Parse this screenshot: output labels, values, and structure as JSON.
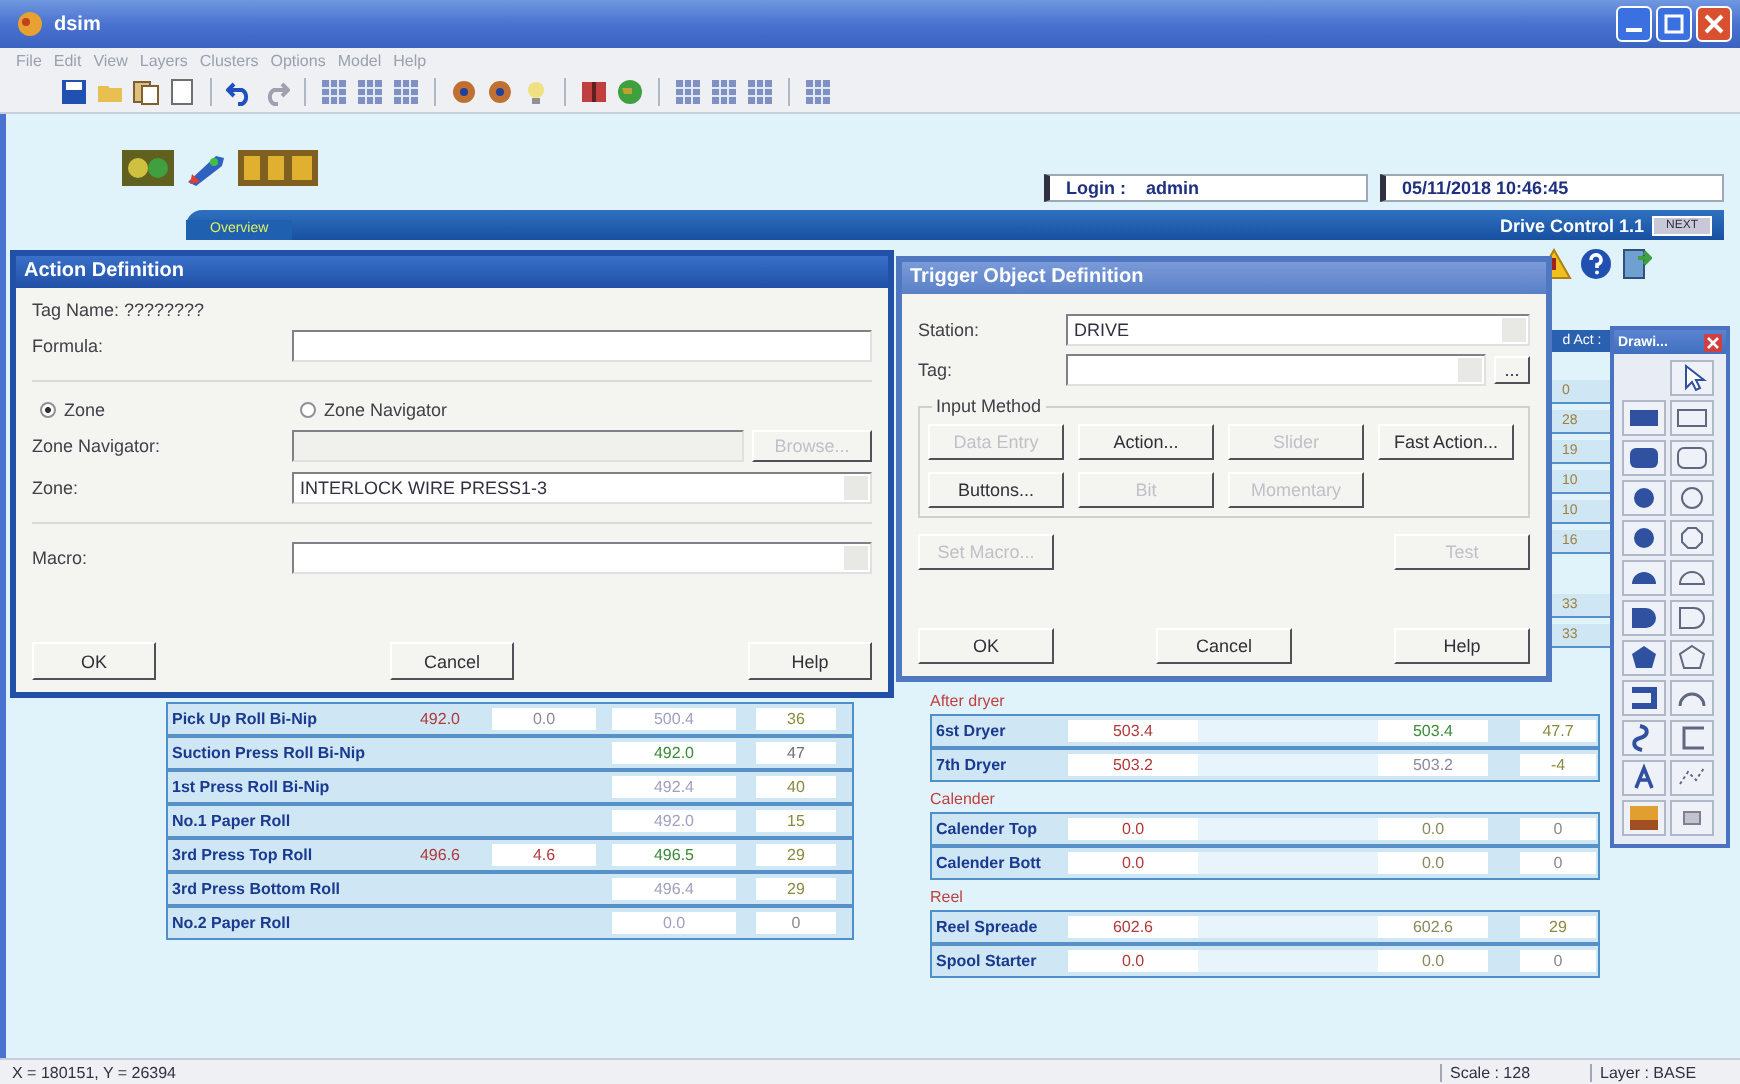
{
  "window": {
    "title": "dsim"
  },
  "menu": [
    "File",
    "Edit",
    "View",
    "Layers",
    "Clusters",
    "Options",
    "Model",
    "Help"
  ],
  "header": {
    "login_label": "Login :",
    "login_user": "admin",
    "datetime": "05/11/2018 10:46:45",
    "tab": "Overview",
    "screen_title": "Drive Control 1.1",
    "next_button": "NEXT"
  },
  "partial_column": {
    "header": "d Act :",
    "values": [
      "0",
      "28",
      "19",
      "10",
      "10",
      "16"
    ],
    "values_lower": [
      "33",
      "33"
    ]
  },
  "left_table": {
    "rows": [
      {
        "name": "Pick Up Roll Bi-Nip",
        "column_2": {
          "text": "492.0",
          "color": "#b03a3a"
        },
        "column_3": {
          "text": "0.0",
          "color": "#8a8a9a"
        },
        "column_4": {
          "text": "500.4",
          "color": "#a0a0c0"
        },
        "column_5": {
          "text": "36",
          "color": "#8a8a40"
        }
      },
      {
        "name": "Suction Press Roll Bi-Nip",
        "column_4": {
          "text": "492.0",
          "color": "#3a8a3a"
        },
        "column_5": {
          "text": "47",
          "color": "#707070"
        }
      },
      {
        "name": "1st Press Roll Bi-Nip",
        "column_4": {
          "text": "492.4",
          "color": "#a0a0c0"
        },
        "column_5": {
          "text": "40",
          "color": "#8a8a40"
        }
      },
      {
        "name": "No.1 Paper Roll",
        "column_4": {
          "text": "492.0",
          "color": "#a0a0c0"
        },
        "column_5": {
          "text": "15",
          "color": "#8a8a40"
        }
      },
      {
        "name": "3rd Press Top Roll",
        "column_2": {
          "text": "496.6",
          "color": "#b03a3a"
        },
        "column_3": {
          "text": "4.6",
          "color": "#b03a3a"
        },
        "column_4": {
          "text": "496.5",
          "color": "#3a8a3a"
        },
        "column_5": {
          "text": "29",
          "color": "#8a8a40"
        }
      },
      {
        "name": "3rd Press Bottom Roll",
        "column_4": {
          "text": "496.4",
          "color": "#a0a0c0"
        },
        "column_5": {
          "text": "29",
          "color": "#8a8a40"
        }
      },
      {
        "name": "No.2 Paper Roll",
        "column_4": {
          "text": "0.0",
          "color": "#a0a0c0"
        },
        "column_5": {
          "text": "0",
          "color": "#8a8a8a"
        }
      }
    ]
  },
  "right_table": {
    "groups": [
      {
        "label": "After dryer",
        "rows": [
          {
            "name": "6st Dryer",
            "column_2": {
              "text": "503.4",
              "color": "#b03a3a"
            },
            "column_3": {
              "text": "503.4",
              "color": "#3a8a3a"
            },
            "column_4": {
              "text": "47.7",
              "color": "#8a8a40"
            }
          },
          {
            "name": "7th Dryer",
            "column_2": {
              "text": "503.2",
              "color": "#b03a3a"
            },
            "column_3": {
              "text": "503.2",
              "color": "#8a8aa0"
            },
            "column_4": {
              "text": "-4",
              "color": "#8a8a40"
            }
          }
        ]
      },
      {
        "label": "Calender",
        "rows": [
          {
            "name": "Calender Top",
            "column_2": {
              "text": "0.0",
              "color": "#b03a3a"
            },
            "column_3": {
              "text": "0.0",
              "color": "#8a8a60"
            },
            "column_4": {
              "text": "0",
              "color": "#8a8a8a"
            }
          },
          {
            "name": "Calender Bott",
            "column_2": {
              "text": "0.0",
              "color": "#b03a3a"
            },
            "column_3": {
              "text": "0.0",
              "color": "#8a8a60"
            },
            "column_4": {
              "text": "0",
              "color": "#8a8a8a"
            }
          }
        ]
      },
      {
        "label": "Reel",
        "rows": [
          {
            "name": "Reel Spreade",
            "column_2": {
              "text": "602.6",
              "color": "#b03a3a"
            },
            "column_3": {
              "text": "602.6",
              "color": "#8a8a60"
            },
            "column_4": {
              "text": "29",
              "color": "#8a8a40"
            }
          },
          {
            "name": "Spool Starter",
            "column_2": {
              "text": "0.0",
              "color": "#b03a3a"
            },
            "column_3": {
              "text": "0.0",
              "color": "#8a8a60"
            },
            "column_4": {
              "text": "0",
              "color": "#8a8a8a"
            }
          }
        ]
      }
    ]
  },
  "action_dialog": {
    "title": "Action Definition",
    "tag_name": "Tag Name: ????????",
    "formula_label": "Formula:",
    "radios": [
      {
        "label": "Zone",
        "selected": true
      },
      {
        "label": "Zone Navigator",
        "selected": false
      }
    ],
    "zone_navigator_label": "Zone Navigator:",
    "browse_button": {
      "label": "Browse...",
      "disabled": true
    },
    "zone_label": "Zone:",
    "zone_value": "INTERLOCK WIRE PRESS1-3",
    "macro_label": "Macro:",
    "buttons": [
      "OK",
      "Cancel",
      "Help"
    ]
  },
  "trigger_dialog": {
    "title": "Trigger Object Definition",
    "station_label": "Station:",
    "station_value": "DRIVE",
    "tag_label": "Tag:",
    "browse_button": "...",
    "group_label": "Input Method",
    "method_buttons": [
      {
        "label": "Data Entry",
        "disabled": true
      },
      {
        "label": "Action...",
        "disabled": false
      },
      {
        "label": "Slider",
        "disabled": true
      },
      {
        "label": "Fast Action...",
        "disabled": false
      },
      {
        "label": "Buttons...",
        "disabled": false
      },
      {
        "label": "Bit",
        "disabled": true
      },
      {
        "label": "Momentary",
        "disabled": true
      }
    ],
    "macro_button": {
      "label": "Set Macro...",
      "disabled": true
    },
    "test_button": {
      "label": "Test",
      "disabled": true
    },
    "buttons": [
      "OK",
      "Cancel",
      "Help"
    ]
  },
  "toolbox": {
    "title": "Drawi..."
  },
  "status_bar": {
    "coords": "X = 180151, Y = 26394",
    "scale": "Scale : 128",
    "layer": "Layer : BASE"
  }
}
